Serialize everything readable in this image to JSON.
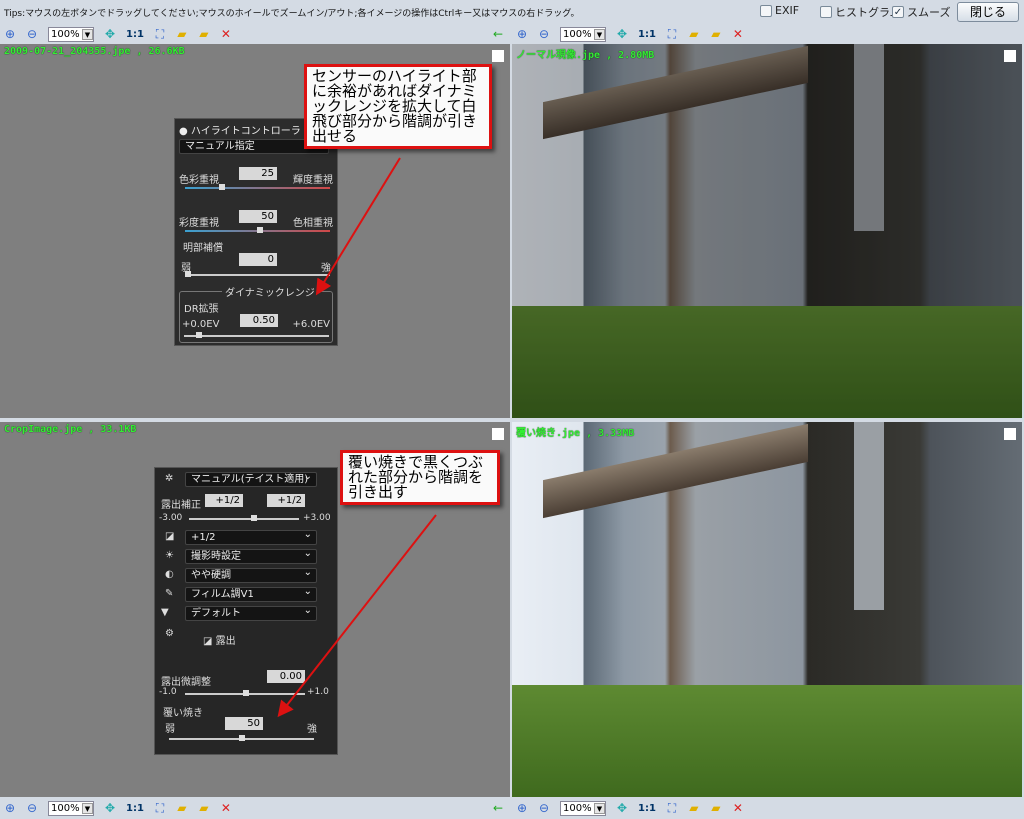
{
  "tips": "Tips:マウスの左ボタンでドラッグしてください;マウスのホイールでズームイン/アウト;各イメージの操作はCtrlキー又はマウスの右ドラッグ。",
  "options": {
    "exif": {
      "label": "EXIF",
      "checked": false
    },
    "histogram": {
      "label": "ヒストグラム",
      "checked": false
    },
    "smooth": {
      "label": "スムーズ",
      "checked": true
    }
  },
  "close_label": "閉じる",
  "toolbar": {
    "zoom": "100%",
    "one_to_one": "1:1"
  },
  "panes": [
    {
      "filename": "2009-07-21_204355.jpe , 26.6KB"
    },
    {
      "filename": "ノーマル現像.jpe , 2.80MB"
    },
    {
      "filename": "CropImage.jpe , 33.1KB"
    },
    {
      "filename": "覆い焼き.jpe , 3.33MB"
    }
  ],
  "highlight": {
    "title": "ハイライトコントローラ",
    "mode": "マニュアル指定",
    "color_left": "色彩重視",
    "color_right": "輝度重視",
    "color_value": "25",
    "sat_left": "彩度重視",
    "sat_right": "色相重視",
    "sat_value": "50",
    "shadow_label": "明部補償",
    "weak": "弱",
    "strong": "強",
    "shadow_value": "0",
    "dr_group": "ダイナミックレンジ",
    "dr_label": "DR拡張",
    "dr_min": "+0.0EV",
    "dr_max": "+6.0EV",
    "dr_value": "0.50"
  },
  "exposure": {
    "mode": "マニュアル(テイスト適用)",
    "comp_label": "露出補正",
    "comp_value1": "+1/2",
    "comp_value2": "+1/2",
    "comp_min": "-3.00",
    "comp_max": "+3.00",
    "comp_select": "+1/2",
    "wb": "撮影時設定",
    "contrast": "やや硬調",
    "film": "フィルム調V1",
    "default": "デフォルト",
    "tab": "露出",
    "fine_label": "露出微調整",
    "fine_value": "0.00",
    "fine_min": "-1.0",
    "fine_max": "+1.0",
    "dodge_label": "覆い焼き",
    "weak": "弱",
    "strong": "強",
    "dodge_value": "50"
  },
  "callouts": {
    "top": "センサーのハイライト部に余裕があればダイナミックレンジを拡大して白飛び部分から階調が引き出せる",
    "bottom": "覆い焼きで黒くつぶれた部分から階調を引き出す"
  },
  "colors": {
    "filename": "#33ee33",
    "callout_border": "#dd1111",
    "arrow": "#dd1111"
  }
}
